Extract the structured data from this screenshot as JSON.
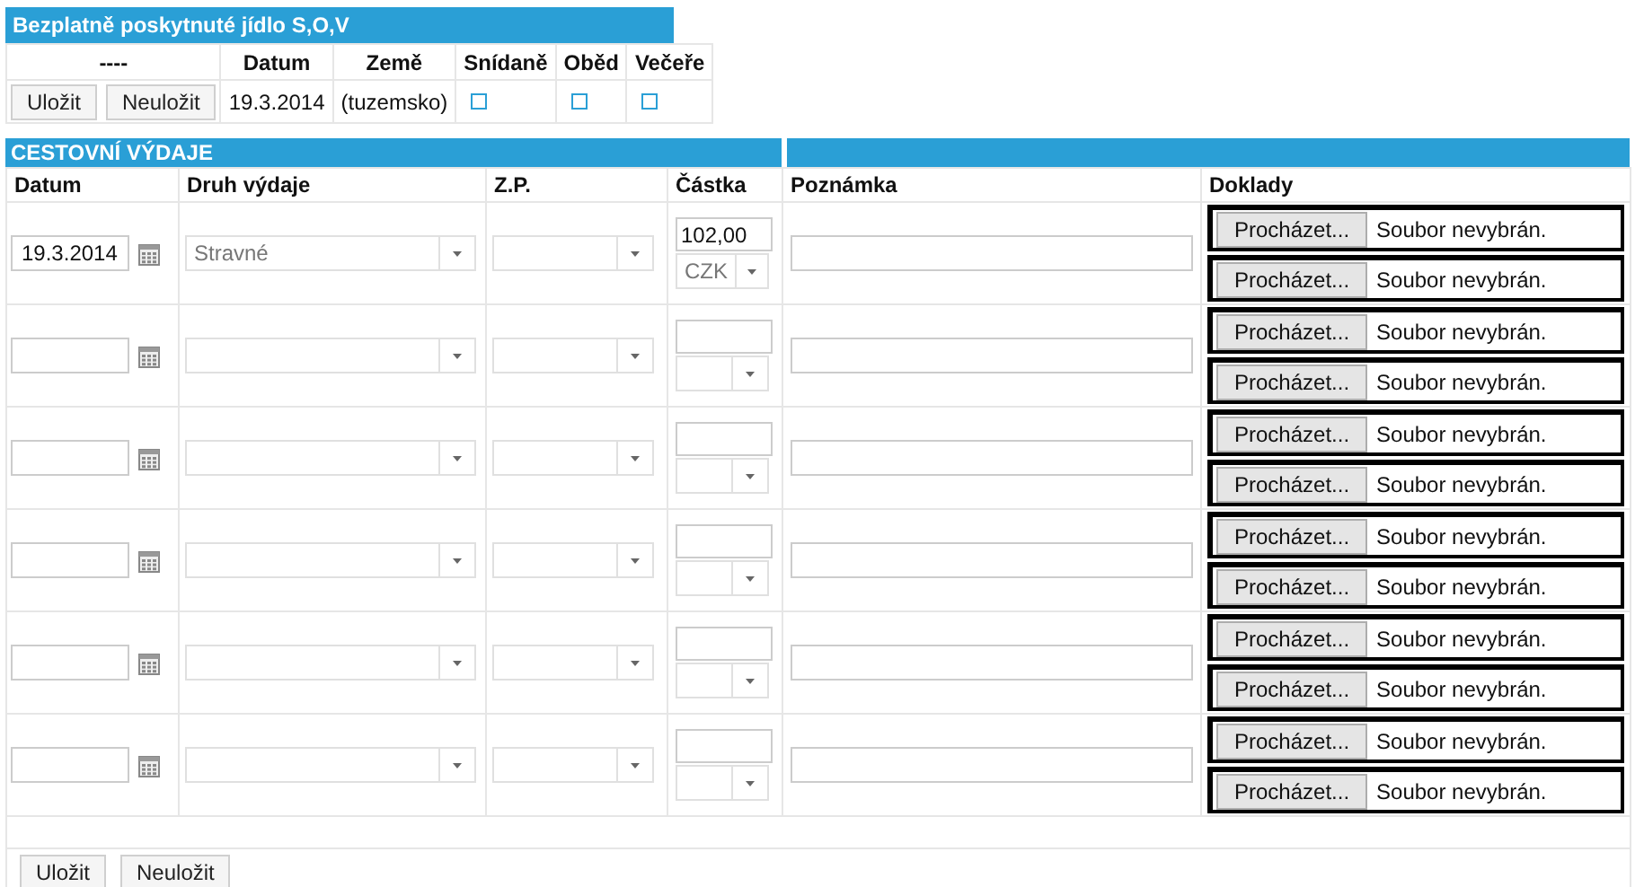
{
  "meals": {
    "title": "Bezplatně poskytnuté jídlo S,O,V",
    "columns": [
      "----",
      "Datum",
      "Země",
      "Snídaně",
      "Oběd",
      "Večeře"
    ],
    "buttons": [
      "Uložit",
      "Neuložit"
    ],
    "date": "19.3.2014",
    "country": "(tuzemsko)",
    "checks": [
      {
        "checked": false
      },
      {
        "checked": false
      },
      {
        "checked": false
      }
    ]
  },
  "expenses": {
    "title": "CESTOVNÍ VÝDAJE",
    "columns": [
      "Datum",
      "Druh výdaje",
      "Z.P.",
      "Částka",
      "Poznámka",
      "Doklady"
    ],
    "rows": [
      {
        "date": "19.3.2014",
        "type": "Stravné",
        "amount": "102,00",
        "currency": "CZK",
        "documents": [
          {
            "button": "Procházet...",
            "status": "Soubor nevybrán."
          },
          {
            "button": "Procházet...",
            "status": "Soubor nevybrán."
          }
        ]
      },
      {
        "documents": [
          {
            "button": "Procházet...",
            "status": "Soubor nevybrán."
          },
          {
            "button": "Procházet...",
            "status": "Soubor nevybrán."
          }
        ]
      },
      {
        "documents": [
          {
            "button": "Procházet...",
            "status": "Soubor nevybrán."
          },
          {
            "button": "Procházet...",
            "status": "Soubor nevybrán."
          }
        ]
      },
      {
        "documents": [
          {
            "button": "Procházet...",
            "status": "Soubor nevybrán."
          },
          {
            "button": "Procházet...",
            "status": "Soubor nevybrán."
          }
        ]
      },
      {
        "documents": [
          {
            "button": "Procházet...",
            "status": "Soubor nevybrán."
          },
          {
            "button": "Procházet...",
            "status": "Soubor nevybrán."
          }
        ]
      },
      {
        "documents": [
          {
            "button": "Procházet...",
            "status": "Soubor nevybrán."
          },
          {
            "button": "Procházet...",
            "status": "Soubor nevybrán."
          }
        ]
      }
    ],
    "buttons": [
      "Uložit",
      "Neuložit"
    ]
  }
}
